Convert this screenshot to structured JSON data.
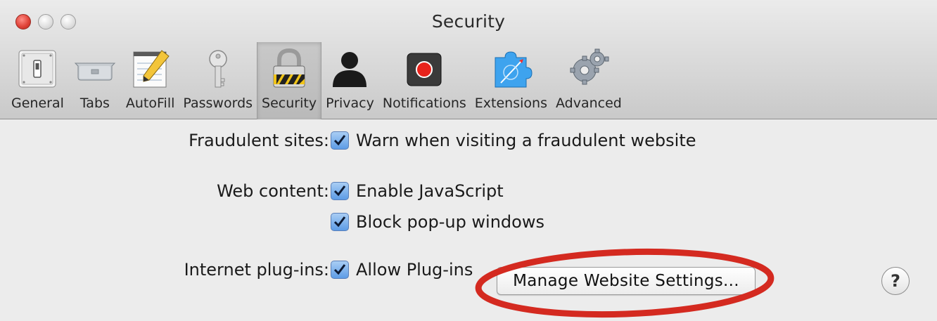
{
  "window": {
    "title": "Security"
  },
  "toolbar": {
    "items": [
      {
        "label": "General",
        "icon": "general-switch-icon",
        "selected": false
      },
      {
        "label": "Tabs",
        "icon": "tabs-icon",
        "selected": false
      },
      {
        "label": "AutoFill",
        "icon": "autofill-pencil-icon",
        "selected": false
      },
      {
        "label": "Passwords",
        "icon": "key-icon",
        "selected": false
      },
      {
        "label": "Security",
        "icon": "padlock-icon",
        "selected": true
      },
      {
        "label": "Privacy",
        "icon": "person-silhouette-icon",
        "selected": false
      },
      {
        "label": "Notifications",
        "icon": "notification-record-icon",
        "selected": false
      },
      {
        "label": "Extensions",
        "icon": "puzzle-compass-icon",
        "selected": false
      },
      {
        "label": "Advanced",
        "icon": "gears-icon",
        "selected": false
      }
    ]
  },
  "security": {
    "fraudulent": {
      "label": "Fraudulent sites:",
      "option": "Warn when visiting a fraudulent website",
      "checked": true
    },
    "web_content": {
      "label": "Web content:",
      "options": [
        {
          "text": "Enable JavaScript",
          "checked": true
        },
        {
          "text": "Block pop-up windows",
          "checked": true
        }
      ]
    },
    "plugins": {
      "label": "Internet plug-ins:",
      "option": "Allow Plug-ins",
      "checked": true,
      "manage_button": "Manage Website Settings..."
    },
    "help_label": "?"
  },
  "colors": {
    "checkbox_blue": "#5d9ce6",
    "annotation_red": "#d42a20",
    "close_red": "#e0443a"
  }
}
